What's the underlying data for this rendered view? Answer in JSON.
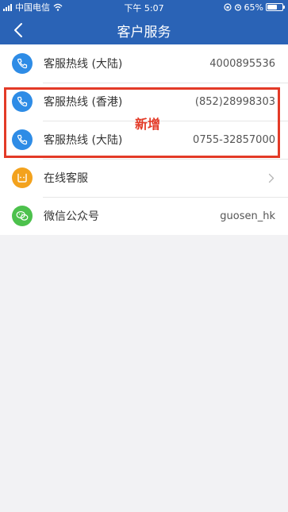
{
  "status_bar": {
    "carrier": "中国电信",
    "time": "下午 5:07",
    "battery_percent": "65%",
    "battery_level": 0.65
  },
  "header": {
    "title": "客户服务",
    "back_icon": "chevron-left-icon"
  },
  "colors": {
    "header_bg": "#2a63b6",
    "phone_icon_bg": "#2e8ce6",
    "online_icon_bg": "#f3a21d",
    "wechat_icon_bg": "#4cc14c",
    "highlight": "#e33a27"
  },
  "list": [
    {
      "label": "客服热线 (大陆)",
      "value": "4000895536",
      "icon": "phone-icon"
    },
    {
      "label": "客服热线 (香港)",
      "value": "(852)28998303",
      "icon": "phone-icon"
    },
    {
      "label": "客服热线 (大陆)",
      "value": "0755-32857000",
      "icon": "phone-icon"
    },
    {
      "label": "在线客服",
      "value": "",
      "icon": "online-service-icon"
    },
    {
      "label": "微信公众号",
      "value": "guosen_hk",
      "icon": "wechat-icon"
    }
  ],
  "annotation": {
    "text": "新增"
  }
}
